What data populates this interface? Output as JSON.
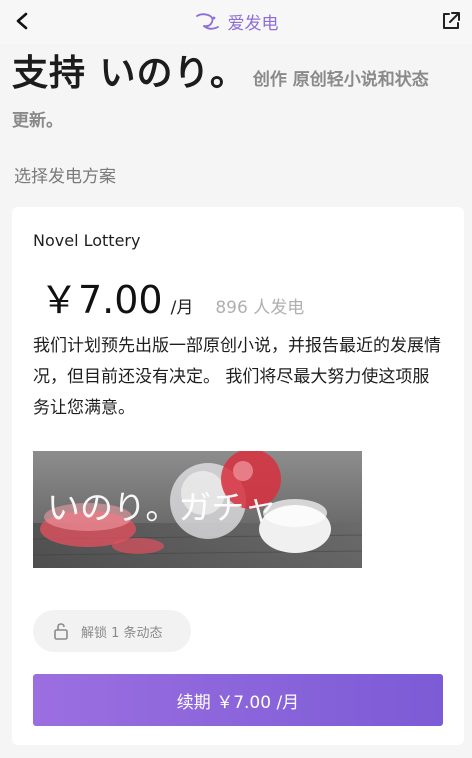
{
  "header": {
    "brand_name": "爱发电",
    "icons": [
      "back-arrow-icon",
      "brand-logo-icon",
      "share-external-icon"
    ]
  },
  "hero": {
    "title": "支持 いのり。",
    "subtitle_part1": "创作 原创轻小说和状态",
    "subtitle_part2": "更新。"
  },
  "section_label": "选择发电方案",
  "plan": {
    "name": "Novel Lottery",
    "price": "￥7.00",
    "price_unit": "/月",
    "supporters": "896 人发电",
    "description": "我们计划预先出版一部原创小说，并报告最近的发展情况，但目前还没有决定。 我们将尽最大努力使这项服务让您满意。",
    "banner_text": "いのり。ガチャ",
    "unlock_label": "解锁 1 条动态",
    "renew_button": "续期 ￥7.00 /月"
  },
  "colors": {
    "accent": "#8f6fd6",
    "button_start": "#9b6fe0",
    "button_end": "#7c5bd6",
    "background": "#f5f5f5"
  }
}
